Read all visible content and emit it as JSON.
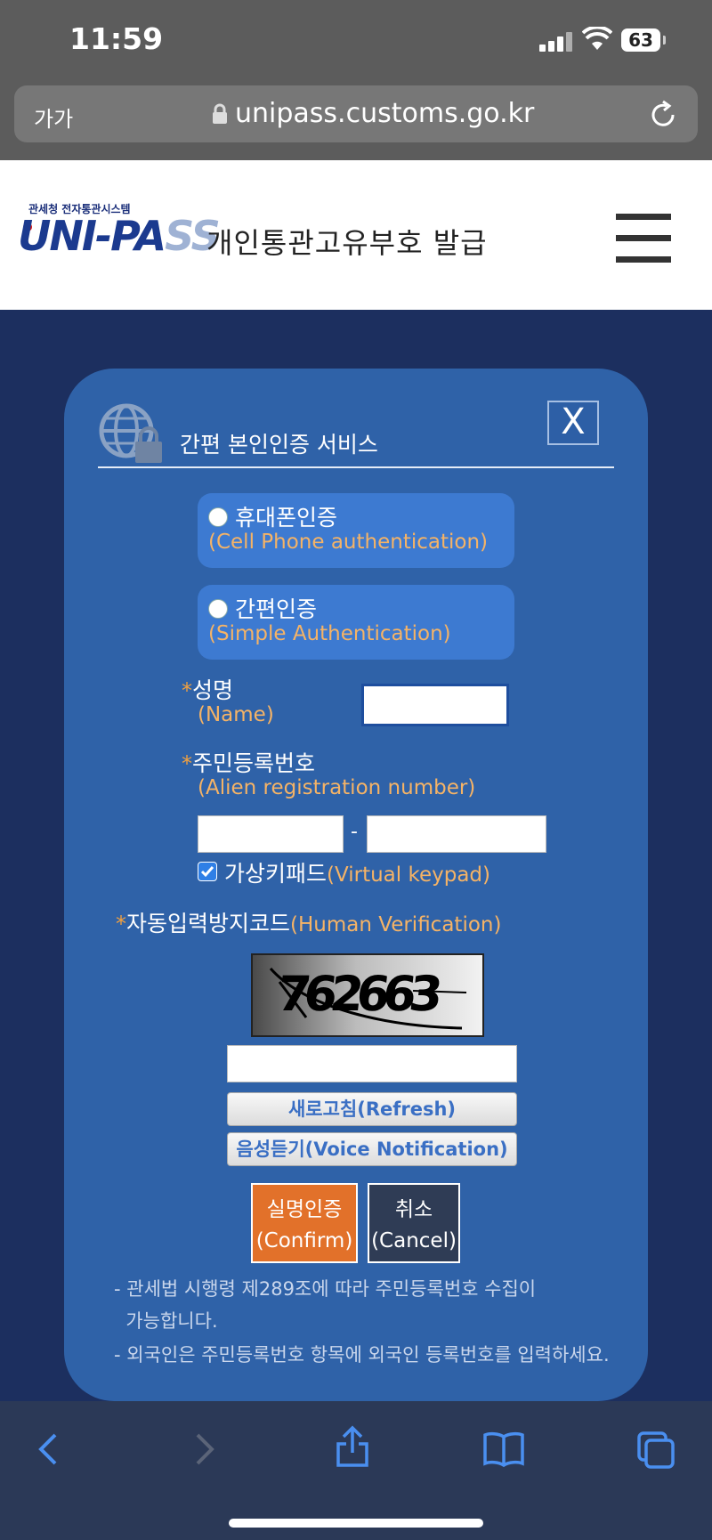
{
  "status": {
    "time": "11:59",
    "battery": "63"
  },
  "browser": {
    "aa": "가가",
    "url": "unipass.customs.go.kr"
  },
  "header": {
    "logo_caption": "관세청 전자통관시스템",
    "logo_uni": "UNI-",
    "logo_pa": "PA",
    "logo_ss": "SS",
    "title": "개인통관고유부호  발급"
  },
  "panel": {
    "title": "간편 본인인증 서비스",
    "close": "X",
    "options": [
      {
        "kr": "휴대폰인증",
        "en": "(Cell Phone authentication)"
      },
      {
        "kr": "간편인증",
        "en": "(Simple Authentication)"
      }
    ],
    "name_kr": "성명",
    "name_en": "(Name)",
    "rrn_kr": "주민등록번호",
    "rrn_en": "(Alien registration number)",
    "rrn_separator": "-",
    "keypad_kr": "가상키패드",
    "keypad_en": "(Virtual keypad)",
    "captcha_kr": "자동입력방지코드",
    "captcha_en": "(Human Verification)",
    "captcha_text": "762663",
    "refresh": "새로고침(Refresh)",
    "voice": "음성듣기(Voice Notification)",
    "confirm_kr": "실명인증",
    "confirm_en": "(Confirm)",
    "cancel_kr": "취소",
    "cancel_en": "(Cancel)",
    "notes": [
      "- 관세법 시행령 제289조에 따라 주민등록번호 수집이",
      "  가능합니다.",
      "- 외국인은 주민등록번호 항목에 외국인 등록번호를 입력하세요."
    ],
    "asterisk": "*"
  },
  "colors": {
    "panel": "#2f62a8",
    "option": "#3d7ad1",
    "accent_text": "#f5b366",
    "confirm": "#e2712a",
    "cancel": "#2f3c55"
  }
}
